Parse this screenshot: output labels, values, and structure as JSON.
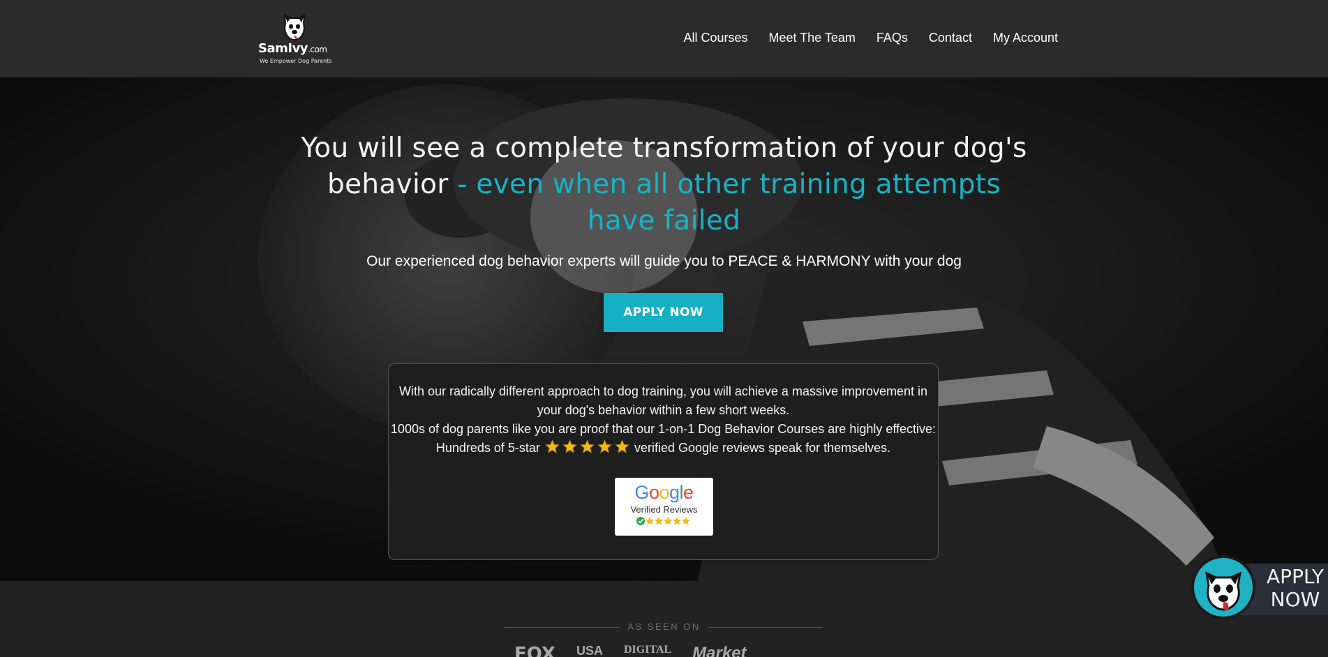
{
  "header": {
    "logo": {
      "name": "SamIvy",
      "suffix": ".com",
      "tagline": "We Empower Dog Parents"
    },
    "nav": [
      "All Courses",
      "Meet The Team",
      "FAQs",
      "Contact",
      "My Account"
    ]
  },
  "hero": {
    "title_plain": "You will see a complete transformation of your dog's behavior",
    "title_accent": " - even when all other training attempts have failed",
    "subtitle": "Our experienced dog behavior experts will guide you to PEACE & HARMONY with your dog",
    "cta_label": "APPLY NOW",
    "info": {
      "line1": "With our radically different approach to dog training, you will achieve a massive improvement in your dog's behavior within a few short weeks.",
      "line2_before": "1000s of dog parents like you are proof that our 1-on-1 Dog Behavior Courses are highly effective: Hundreds of 5-star",
      "line2_after": "verified Google reviews speak for themselves.",
      "star_count": 5,
      "badge": {
        "brand": "Google",
        "label": "Verified Reviews"
      }
    }
  },
  "seen_on": {
    "label": "AS SEEN ON",
    "logos": [
      "FOX",
      "USA",
      "DIGITAL",
      "Market"
    ]
  },
  "float_apply": {
    "line1": "APPLY",
    "line2": "NOW"
  },
  "colors": {
    "accent": "#17b3c6",
    "header_bg": "#2b2b2b",
    "star": "#f5b917"
  }
}
